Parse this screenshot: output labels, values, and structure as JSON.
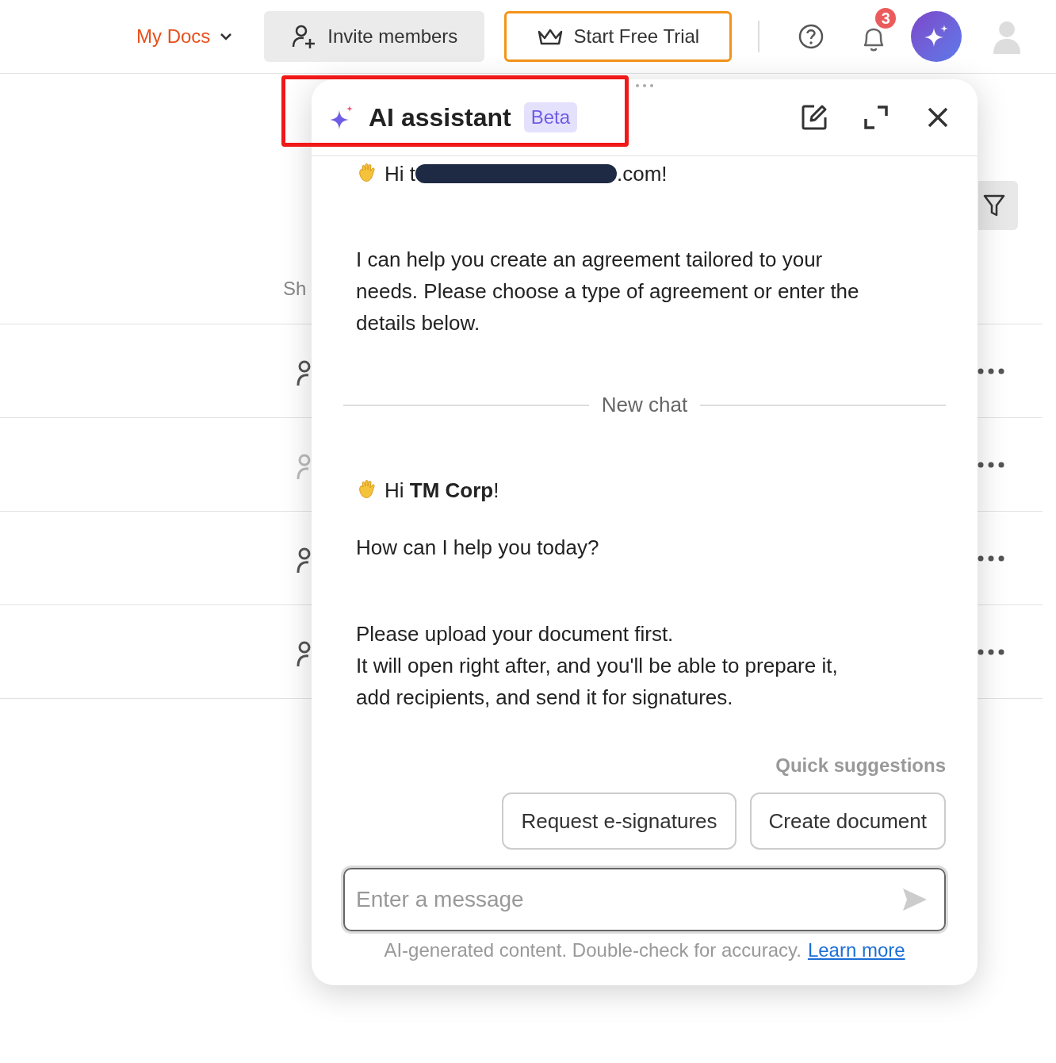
{
  "topbar": {
    "workspace": "My Docs",
    "invite_button": "Invite members",
    "trial_button": "Start Free Trial",
    "notification_count": "3"
  },
  "list": {
    "column_heading": "Sh",
    "rows": [
      {
        "dimmed": false
      },
      {
        "dimmed": true
      },
      {
        "dimmed": false
      },
      {
        "dimmed": false
      }
    ]
  },
  "assistant": {
    "title": "AI assistant",
    "badge": "Beta",
    "greeting_prefix": "Hi t",
    "greeting_suffix": ".com!",
    "intro": "I can help you create an agreement tailored to your needs. Please choose a type of agreement or enter the details below.",
    "divider_label": "New chat",
    "greeting2": "Hi **TM Corp**!",
    "question": "How can I help you today?",
    "instructions": [
      "Please upload your document first.",
      "It will open right after, and you'll be able to prepare it, add recipients, and send it for signatures."
    ],
    "suggestions_label": "Quick suggestions",
    "suggestions": [
      "Request e-signatures",
      "Create document"
    ],
    "input": {
      "placeholder": "Enter a message"
    },
    "disclaimer": "AI-generated content. Double-check for accuracy.",
    "link": "Learn more"
  }
}
